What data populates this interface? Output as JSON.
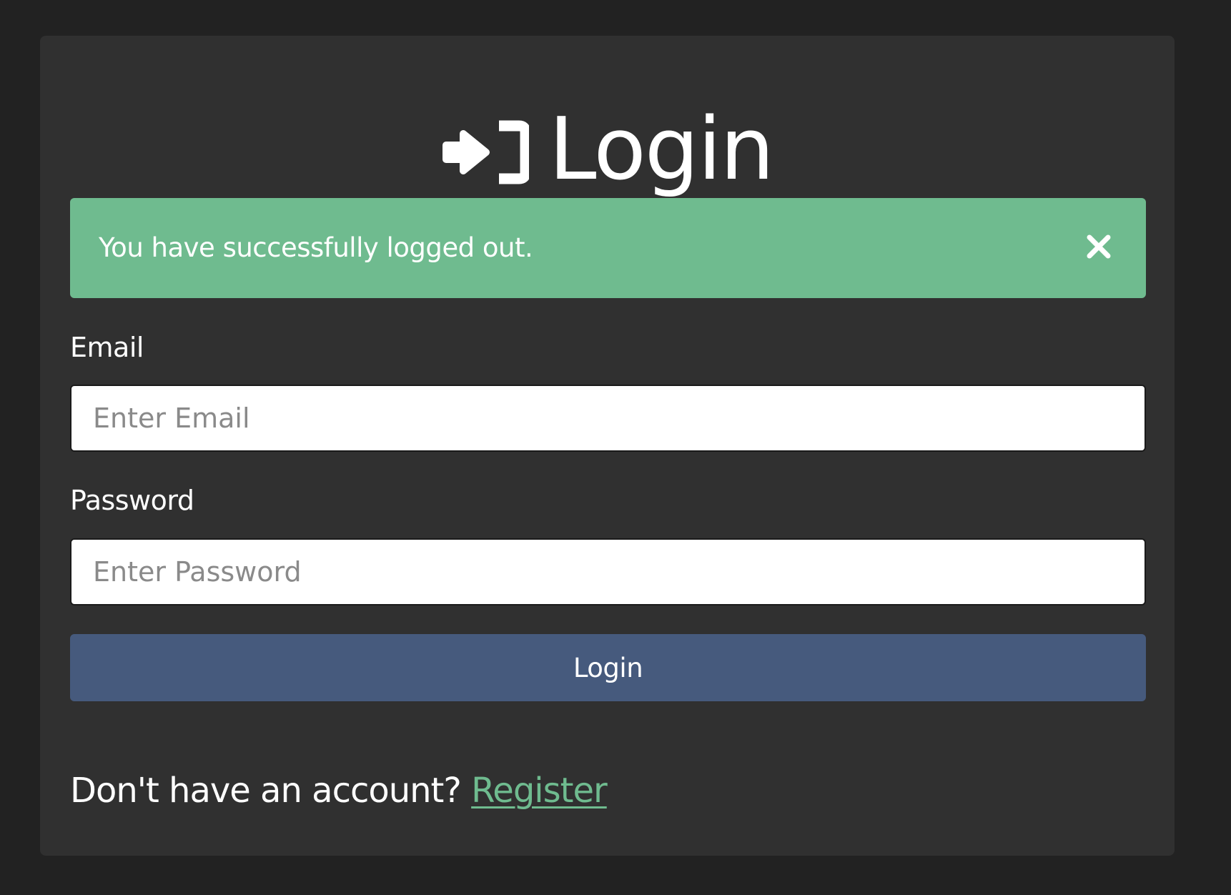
{
  "header": {
    "icon": "sign-in-icon",
    "title": "Login"
  },
  "alert": {
    "message": "You have successfully logged out.",
    "close_icon": "close-icon",
    "color": "#6fbb8f"
  },
  "form": {
    "email_label": "Email",
    "email_placeholder": "Enter Email",
    "email_value": "",
    "password_label": "Password",
    "password_placeholder": "Enter Password",
    "password_value": "",
    "submit_label": "Login",
    "submit_color": "#465a7d"
  },
  "footer": {
    "prompt": "Don't have an account?",
    "link_label": "Register",
    "link_color": "#6fbb8f"
  }
}
